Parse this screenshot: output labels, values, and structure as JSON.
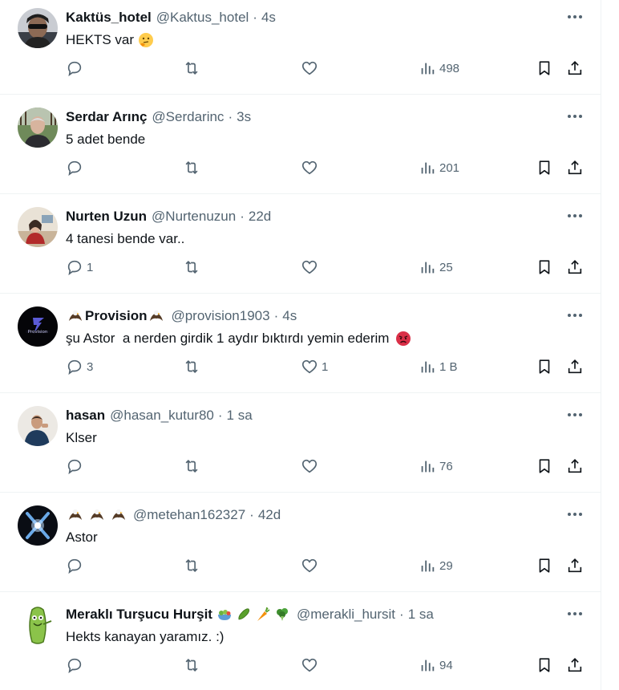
{
  "tweets": [
    {
      "name": "Kaktüs_hotel",
      "name_emojis": [],
      "handle": "@Kaktus_hotel",
      "time": "4s",
      "text": "HEKTS var",
      "text_emoji": "thinking-face",
      "replies": "",
      "retweets": "",
      "likes": "",
      "views": "498",
      "avatar": "man-sunglasses"
    },
    {
      "name": "Serdar Arınç",
      "name_emojis": [],
      "handle": "@Serdarinc",
      "time": "3s",
      "text": "5 adet bende",
      "text_emoji": "",
      "replies": "",
      "retweets": "",
      "likes": "",
      "views": "201",
      "avatar": "man-outdoors"
    },
    {
      "name": "Nurten Uzun",
      "name_emojis": [],
      "handle": "@Nurtenuzun",
      "time": "22d",
      "text": "4 tanesi bende var..",
      "text_emoji": "",
      "replies": "1",
      "retweets": "",
      "likes": "",
      "views": "25",
      "avatar": "woman-desk"
    },
    {
      "name": "Provision",
      "name_emojis": [
        "eagle",
        "eagle"
      ],
      "handle": "@provision1903",
      "time": "4s",
      "text": "şu Astor  a nerden girdik 1 aydır bıktırdı yemin ederim",
      "text_emoji": "angry-face",
      "replies": "3",
      "retweets": "",
      "likes": "1",
      "views": "1 B",
      "avatar": "provision-logo"
    },
    {
      "name": "hasan",
      "name_emojis": [],
      "handle": "@hasan_kutur80",
      "time": "1 sa",
      "text": "Klser",
      "text_emoji": "",
      "replies": "",
      "retweets": "",
      "likes": "",
      "views": "76",
      "avatar": "man-suit"
    },
    {
      "name": "",
      "name_emojis": [
        "eagle",
        "eagle",
        "eagle"
      ],
      "handle": "@metehan162327",
      "time": "42d",
      "text": "Astor",
      "text_emoji": "",
      "replies": "",
      "retweets": "",
      "likes": "",
      "views": "29",
      "avatar": "blue-x"
    },
    {
      "name": "Meraklı Turşucu Hurşit",
      "name_emojis": [
        "salad",
        "cucumber",
        "carrot",
        "broccoli"
      ],
      "handle": "@merakli_hursit",
      "time": "1 sa",
      "text": "Hekts kanayan yaramız. :)",
      "text_emoji": "",
      "replies": "",
      "retweets": "",
      "likes": "",
      "views": "94",
      "avatar": "pickle-cartoon"
    }
  ],
  "icons": {
    "reply": "reply-icon",
    "retweet": "retweet-icon",
    "like": "heart-icon",
    "views": "views-icon",
    "bookmark": "bookmark-icon",
    "share": "share-icon",
    "more": "more-icon"
  },
  "colors": {
    "text": "#0f1419",
    "secondary": "#536471",
    "border": "#eff3f4"
  }
}
